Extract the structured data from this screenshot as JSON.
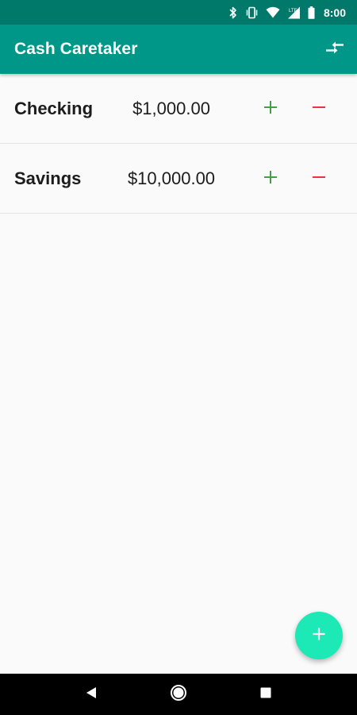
{
  "status_bar": {
    "time": "8:00",
    "icons": [
      "bluetooth-icon",
      "vibrate-icon",
      "wifi-icon",
      "lte-signal-icon",
      "battery-icon"
    ]
  },
  "app_bar": {
    "title": "Cash Caretaker",
    "action_icon": "swap-icon"
  },
  "accounts": [
    {
      "name": "Checking",
      "amount": "$1,000.00"
    },
    {
      "name": "Savings",
      "amount": "$10,000.00"
    }
  ],
  "fab": {
    "icon": "plus-icon"
  },
  "nav_bar": {
    "buttons": [
      "back-icon",
      "home-icon",
      "recents-icon"
    ]
  },
  "colors": {
    "status_bar": "#00796b",
    "app_bar": "#009688",
    "fab": "#1de9b6",
    "plus": "#43a047",
    "minus": "#e53935",
    "background": "#fafafa"
  }
}
